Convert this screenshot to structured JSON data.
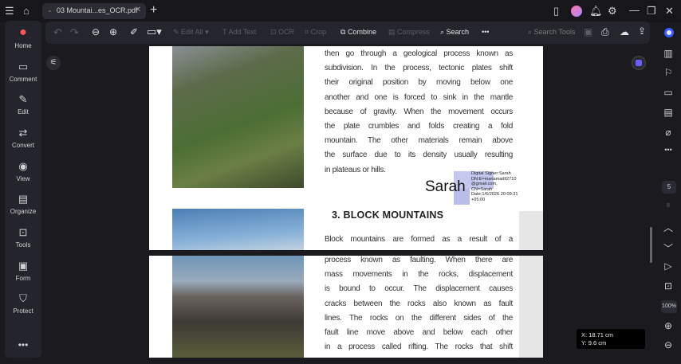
{
  "titlebar": {
    "tab_title": "03 Mountai...es_OCR.pdf"
  },
  "sidebar": {
    "items": [
      {
        "label": "Home",
        "icon": "home-logo-icon"
      },
      {
        "label": "Comment",
        "icon": "comment-icon"
      },
      {
        "label": "Edit",
        "icon": "edit-icon"
      },
      {
        "label": "Convert",
        "icon": "convert-icon"
      },
      {
        "label": "View",
        "icon": "eye-icon"
      },
      {
        "label": "Organize",
        "icon": "organize-icon"
      },
      {
        "label": "Tools",
        "icon": "toolbox-icon"
      },
      {
        "label": "Form",
        "icon": "form-icon"
      },
      {
        "label": "Protect",
        "icon": "shield-icon"
      }
    ]
  },
  "toolbar": {
    "edit_all": "Edit All",
    "add_text": "Add Text",
    "ocr": "OCR",
    "crop": "Crop",
    "combine": "Combine",
    "compress": "Compress",
    "search": "Search",
    "search_tools": "Search Tools"
  },
  "document": {
    "para1": [
      "then go through a geological process known as",
      "subdivision. In the process, tectonic plates shift",
      "their original position by moving below one",
      "another and one is forced to sink in the mantle",
      "because of gravity. When the movement occurs",
      "the plate crumbles and folds creating a fold",
      "mountain. The other materials remain above",
      "the surface due to its density usually resulting"
    ],
    "para1_last": "in plateaus or hills.",
    "signature": {
      "name": "Sarah",
      "details": [
        "Digital Signer:Sarah",
        "DN:E=mariamadil2710",
        "@gmail.com,",
        "CN=Sarah",
        "Date:1/6/2026 20:09:31",
        "+05:00"
      ]
    },
    "heading": "3. BLOCK MOUNTAINS",
    "para2_first": "Block mountains are formed as a result of a",
    "para3": [
      "process known as faulting. When there are",
      "mass movements in the rocks, displacement",
      "is bound to occur. The displacement causes",
      "cracks between the rocks also known as fault",
      "lines. The rocks on the different sides of the",
      "fault line move above and below each other",
      "in a process called rifting. The rocks that shift"
    ]
  },
  "right_panel": {
    "current_page": "5",
    "total_pages": "8",
    "zoom": "100%"
  },
  "coords": {
    "x": "X: 18.71 cm",
    "y": "Y: 9.6 cm"
  }
}
